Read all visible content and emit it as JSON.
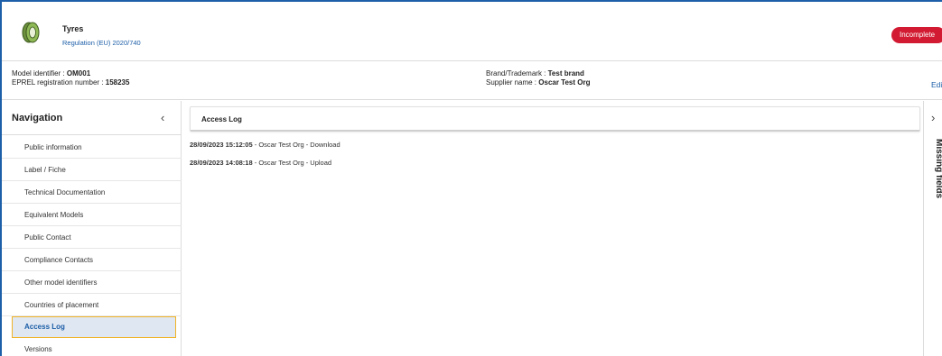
{
  "header": {
    "product_title": "Tyres",
    "regulation": "Regulation (EU) 2020/740",
    "status": "Incomplete",
    "status_color": "#d21b32"
  },
  "info": {
    "model_identifier_label": "Model identifier : ",
    "model_identifier_value": "OM001",
    "eprel_label": "EPREL registration number : ",
    "eprel_value": "158235",
    "brand_label": "Brand/Trademark : ",
    "brand_value": "Test brand",
    "supplier_label": "Supplier name : ",
    "supplier_value": "Oscar Test Org",
    "edit_label": "Edi"
  },
  "navigation": {
    "title": "Navigation",
    "items": [
      {
        "label": "Public information"
      },
      {
        "label": "Label / Fiche"
      },
      {
        "label": "Technical Documentation"
      },
      {
        "label": "Equivalent Models"
      },
      {
        "label": "Public Contact"
      },
      {
        "label": "Compliance Contacts"
      },
      {
        "label": "Other model identifiers"
      },
      {
        "label": "Countries of placement"
      },
      {
        "label": "Access Log"
      },
      {
        "label": "Versions"
      }
    ],
    "active_index": 8
  },
  "access_log": {
    "title": "Access Log",
    "entries": [
      {
        "timestamp": "28/09/2023 15:12:05",
        "detail": " - Oscar Test Org - Download"
      },
      {
        "timestamp": "28/09/2023 14:08:18",
        "detail": " - Oscar Test Org - Upload"
      }
    ]
  },
  "right_panel": {
    "label": "Missing fields"
  },
  "icons": {
    "tyre": "tyre-icon",
    "collapse": "chevron-left-icon",
    "expand": "chevron-right-icon"
  },
  "colors": {
    "accent": "#1d5fa8",
    "active_border": "#f0b429",
    "active_bg": "#dfe7f2"
  }
}
